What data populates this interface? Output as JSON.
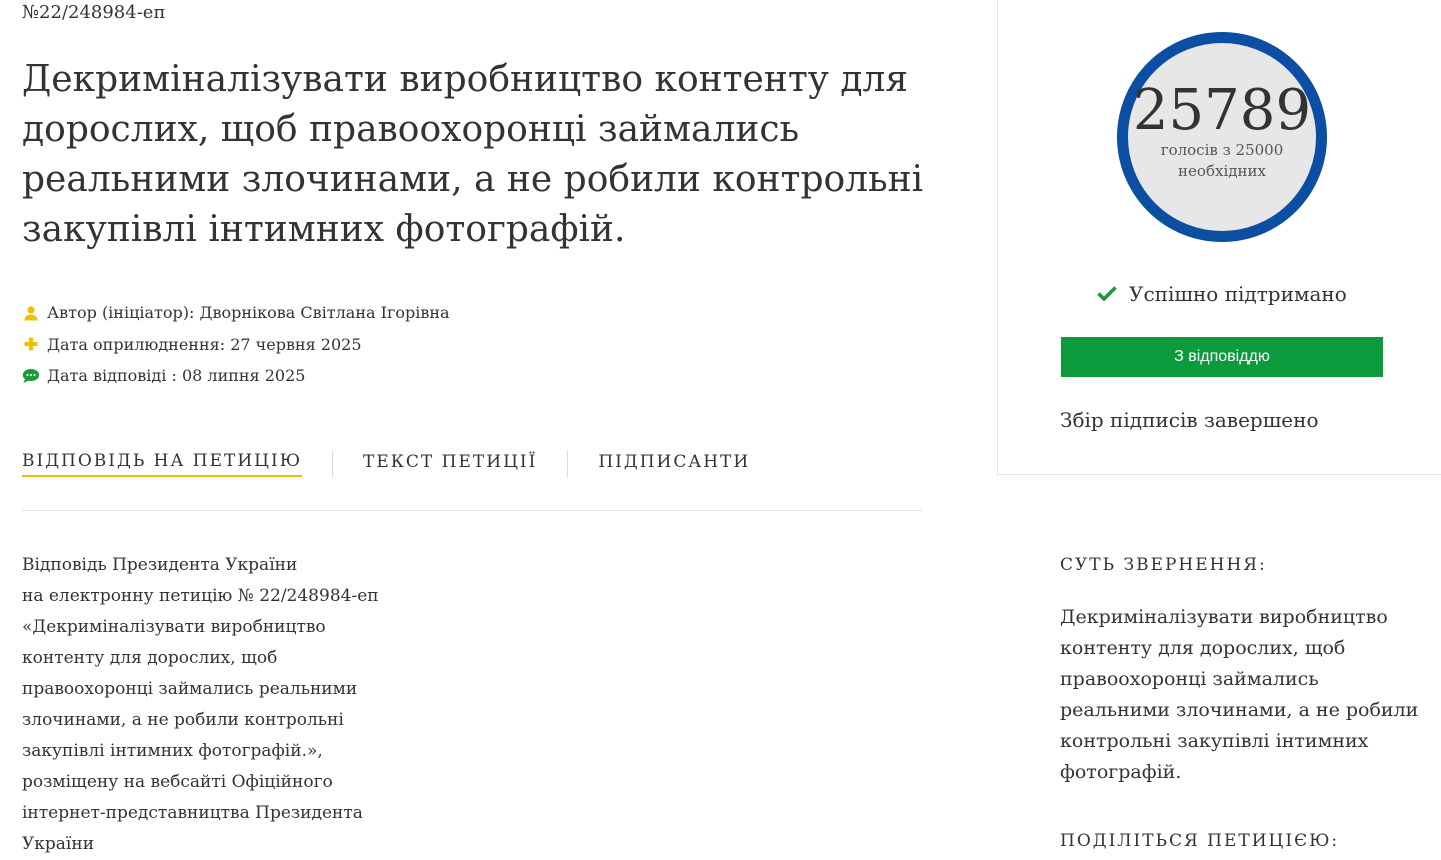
{
  "petition": {
    "number": "№22/248984-еп",
    "title": "Декриміналізувати виробництво контенту для дорослих, щоб правоохоронці займались реальними злочинами, а не робили контрольні закупівлі інтимних фотографій."
  },
  "meta": {
    "author": "Автор (ініціатор): Дворнікова Світлана Ігорівна",
    "published": "Дата оприлюднення: 27 червня 2025",
    "answered": "Дата відповіді : 08 липня 2025",
    "icons": [
      "user-icon",
      "plus-icon",
      "comment-icon"
    ]
  },
  "tabs": [
    {
      "label": "ВІДПОВІДЬ НА ПЕТИЦІЮ",
      "active": true
    },
    {
      "label": "ТЕКСТ ПЕТИЦІЇ",
      "active": false
    },
    {
      "label": "ПІДПИСАНТИ",
      "active": false
    }
  ],
  "answer": {
    "lines": [
      "Відповідь Президента України",
      "на електронну петицію № 22/248984-еп",
      "«Декриміналізувати виробництво",
      "контенту для дорослих, щоб",
      "правоохоронці займались реальними",
      "злочинами, а не робили контрольні",
      "закупівлі інтимних фотографій.»,",
      "розміщену на вебсайті Офіційного",
      "інтернет-представництва Президента",
      "України"
    ]
  },
  "sidebar": {
    "votes": "25789",
    "votes_caption": "голосів з 25000 необхідних",
    "status": "Успішно підтримано",
    "answer_button": "З відповіддю",
    "collection_status": "Збір підписів завершено",
    "essence_heading": "СУТЬ ЗВЕРНЕННЯ:",
    "essence_lines": [
      "Декриміналізувати виробництво",
      "контенту для дорослих, щоб",
      "правоохоронці займались",
      "реальними злочинами, а не робили",
      "контрольні закупівлі інтимних",
      "фотографій."
    ],
    "share_heading": "ПОДІЛІТЬСЯ ПЕТИЦІЄЮ:"
  },
  "colors": {
    "accent_yellow": "#e5c100",
    "circle_blue": "#0b4ea2",
    "success_green": "#0b9b3c",
    "author_icon": "#f5bd00",
    "comment_icon": "#1a9b3a"
  }
}
